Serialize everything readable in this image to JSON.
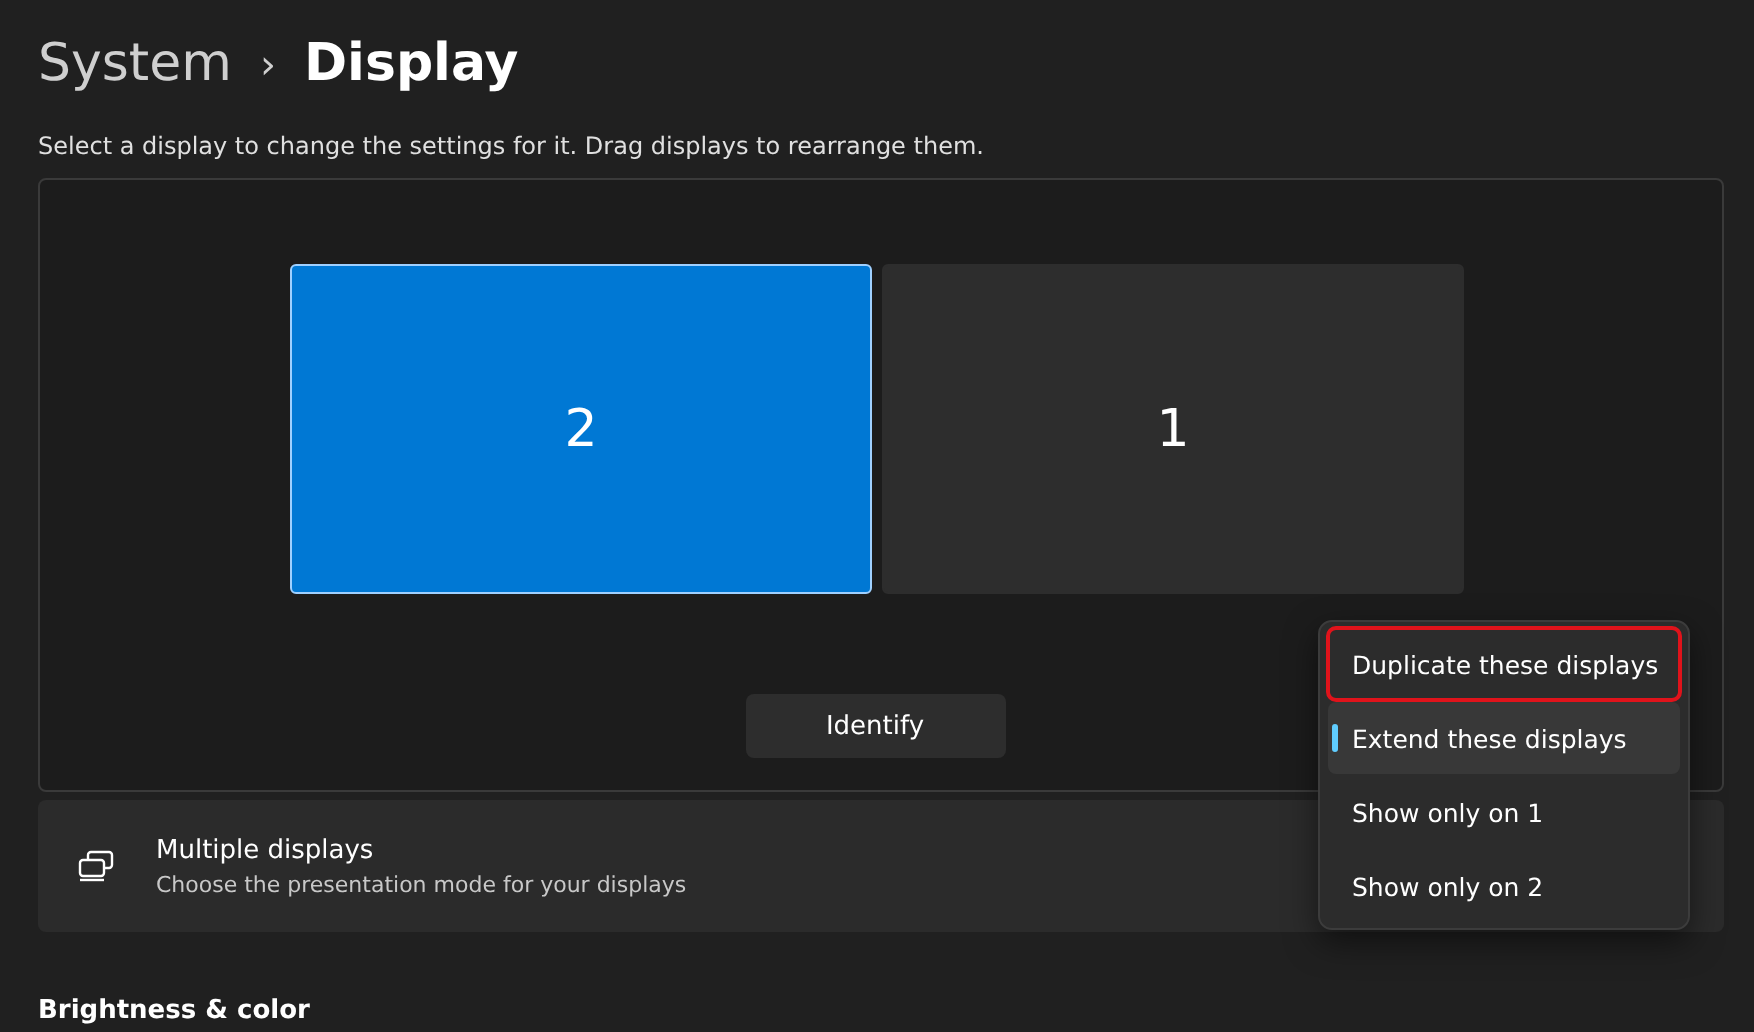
{
  "breadcrumb": {
    "parent": "System",
    "separator": "›",
    "current": "Display"
  },
  "instructions": "Select a display to change the settings for it. Drag displays to rearrange them.",
  "displays": [
    {
      "label": "2",
      "selected": true
    },
    {
      "label": "1",
      "selected": false
    }
  ],
  "identify_button": "Identify",
  "multiple_displays": {
    "title": "Multiple displays",
    "description": "Choose the presentation mode for your displays"
  },
  "menu": [
    {
      "label": "Duplicate these displays",
      "selected": false,
      "outlined": true
    },
    {
      "label": "Extend these displays",
      "selected": true,
      "outlined": false
    },
    {
      "label": "Show only on 1",
      "selected": false,
      "outlined": false
    },
    {
      "label": "Show only on 2",
      "selected": false,
      "outlined": false
    }
  ],
  "section_heading": "Brightness & color"
}
